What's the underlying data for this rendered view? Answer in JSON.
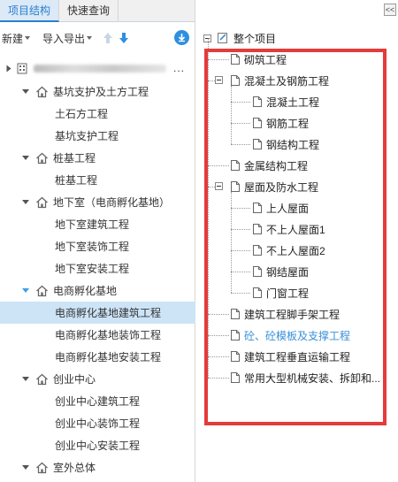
{
  "left": {
    "tabs": [
      {
        "label": "项目结构",
        "active": true
      },
      {
        "label": "快速查询",
        "active": false
      }
    ],
    "toolbar": {
      "new_label": "新建",
      "import_export_label": "导入导出"
    },
    "root_more": "...",
    "tree": [
      {
        "label": "基坑支护及土方工程",
        "level": 1,
        "expanded": true
      },
      {
        "label": "土石方工程",
        "level": 2
      },
      {
        "label": "基坑支护工程",
        "level": 2
      },
      {
        "label": "桩基工程",
        "level": 1,
        "expanded": true
      },
      {
        "label": "桩基工程",
        "level": 2
      },
      {
        "label": "地下室（电商孵化基地）",
        "level": 1,
        "expanded": true
      },
      {
        "label": "地下室建筑工程",
        "level": 2
      },
      {
        "label": "地下室装饰工程",
        "level": 2
      },
      {
        "label": "地下室安装工程",
        "level": 2
      },
      {
        "label": "电商孵化基地",
        "level": 1,
        "expanded": true,
        "accent": true
      },
      {
        "label": "电商孵化基地建筑工程",
        "level": 2,
        "selected": true
      },
      {
        "label": "电商孵化基地装饰工程",
        "level": 2
      },
      {
        "label": "电商孵化基地安装工程",
        "level": 2
      },
      {
        "label": "创业中心",
        "level": 1,
        "expanded": true
      },
      {
        "label": "创业中心建筑工程",
        "level": 2
      },
      {
        "label": "创业中心装饰工程",
        "level": 2
      },
      {
        "label": "创业中心安装工程",
        "level": 2
      },
      {
        "label": "室外总体",
        "level": 1,
        "expanded": true
      }
    ]
  },
  "right": {
    "collapse_label": "<<",
    "root_label": "整个项目",
    "items": [
      {
        "label": "砌筑工程",
        "level": 1
      },
      {
        "label": "混凝土及钢筋工程",
        "level": 1,
        "expandable": true
      },
      {
        "label": "混凝土工程",
        "level": 2
      },
      {
        "label": "钢筋工程",
        "level": 2
      },
      {
        "label": "钢结构工程",
        "level": 2
      },
      {
        "label": "金属结构工程",
        "level": 1
      },
      {
        "label": "屋面及防水工程",
        "level": 1,
        "expandable": true
      },
      {
        "label": "上人屋面",
        "level": 2
      },
      {
        "label": "不上人屋面1",
        "level": 2
      },
      {
        "label": "不上人屋面2",
        "level": 2
      },
      {
        "label": "钢结屋面",
        "level": 2
      },
      {
        "label": "门窗工程",
        "level": 2
      },
      {
        "label": "建筑工程脚手架工程",
        "level": 1
      },
      {
        "label": "砼、砼模板及支撑工程",
        "level": 1,
        "link": true
      },
      {
        "label": "建筑工程垂直运输工程",
        "level": 1
      },
      {
        "label": "常用大型机械安装、拆卸和...",
        "level": 1
      }
    ]
  },
  "colors": {
    "accent": "#2a7fd0",
    "selected_bg": "#cde4f7",
    "highlight_box": "#e43b3b",
    "link": "#3a8fd6"
  }
}
